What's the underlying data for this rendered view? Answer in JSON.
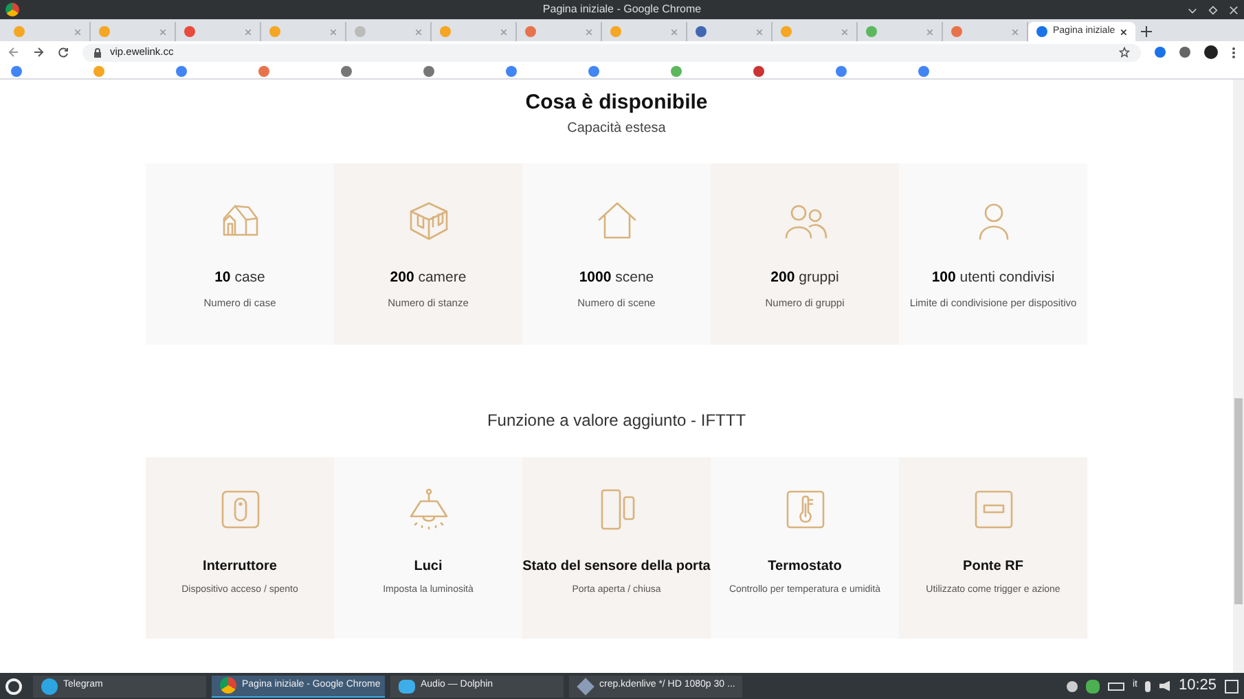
{
  "window": {
    "title": "Pagina iniziale - Google Chrome"
  },
  "tabs": [
    {
      "selected": false,
      "color": "#f5a623"
    },
    {
      "selected": false,
      "color": "#f5a623"
    },
    {
      "selected": false,
      "color": "#e84b3c"
    },
    {
      "selected": false,
      "color": "#f5a623"
    },
    {
      "selected": false,
      "color": "#bbbbbb"
    },
    {
      "selected": false,
      "color": "#f5a623"
    },
    {
      "selected": false,
      "color": "#e8734b"
    },
    {
      "selected": false,
      "color": "#f5a623"
    },
    {
      "selected": false,
      "color": "#4267b2"
    },
    {
      "selected": false,
      "color": "#f5a623"
    },
    {
      "selected": false,
      "color": "#5cb85c"
    },
    {
      "selected": false,
      "color": "#e8734b"
    },
    {
      "selected": true,
      "color": "#1a73e8",
      "label": "Pagina iniziale"
    }
  ],
  "address": {
    "value": "vip.ewelink.cc"
  },
  "page": {
    "title": "Cosa è disponibile",
    "subtitle": "Capacità estesa",
    "capacity": [
      {
        "kind": "house",
        "number": "10",
        "unit": "case",
        "caption": "Numero di case"
      },
      {
        "kind": "room",
        "number": "200",
        "unit": "camere",
        "caption": "Numero di stanze"
      },
      {
        "kind": "home",
        "number": "1000",
        "unit": "scene",
        "caption": "Numero di scene"
      },
      {
        "kind": "group",
        "number": "200",
        "unit": "gruppi",
        "caption": "Numero di gruppi"
      },
      {
        "kind": "user",
        "number": "100",
        "unit": "utenti condivisi",
        "caption": "Limite di condivisione per dispositivo"
      }
    ],
    "section_title": "Funzione a valore aggiunto - IFTTT",
    "features": [
      {
        "kind": "switch",
        "title": "Interruttore",
        "caption": "Dispositivo acceso / spento"
      },
      {
        "kind": "lamp",
        "title": "Luci",
        "caption": "Imposta la luminosità"
      },
      {
        "kind": "door",
        "title": "Stato del sensore della porta",
        "caption": "Porta aperta / chiusa"
      },
      {
        "kind": "thermo",
        "title": "Termostato",
        "caption": "Controllo per temperatura e umidità"
      },
      {
        "kind": "rf",
        "title": "Ponte RF",
        "caption": "Utilizzato come trigger e azione"
      }
    ]
  },
  "taskbar": {
    "items": [
      {
        "label": "Telegram",
        "selected": false,
        "kind": "telegram"
      },
      {
        "label": "Pagina iniziale - Google Chrome",
        "selected": true,
        "kind": "chrome"
      },
      {
        "label": "Audio — Dolphin",
        "selected": false,
        "kind": "folder"
      },
      {
        "label": "crep.kdenlive */ HD 1080p 30 ...",
        "selected": false,
        "kind": "video"
      }
    ],
    "keyboard": "it",
    "clock": "10:25"
  }
}
